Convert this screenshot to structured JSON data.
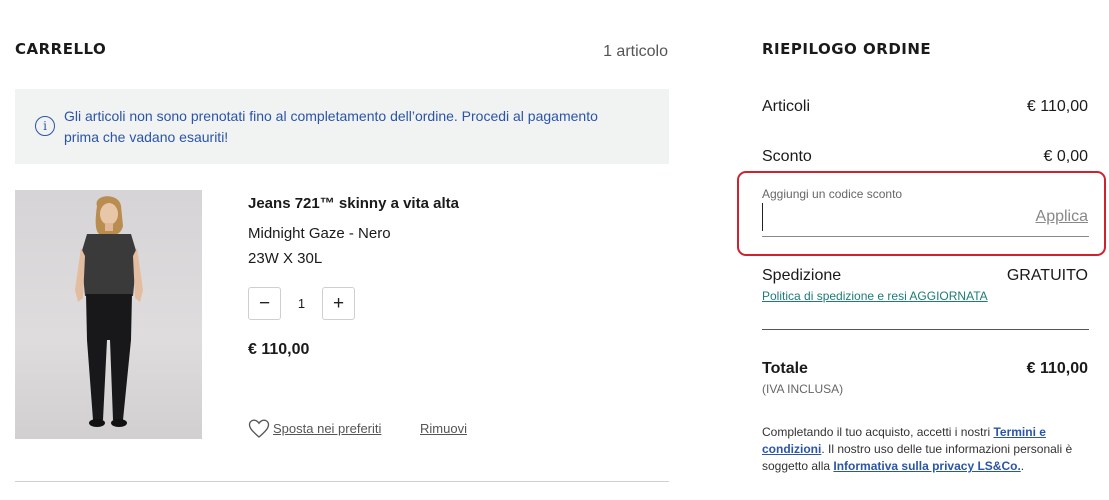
{
  "cart": {
    "title": "CARRELLO",
    "count": "1 articolo",
    "notice": "Gli articoli non sono prenotati fino al completamento dell’ordine. Procedi al pagamento prima che vadano esauriti!",
    "item": {
      "name": "Jeans 721™ skinny a vita alta",
      "color": "Midnight Gaze - Nero",
      "size": "23W X 30L",
      "quantity": "1",
      "minus": "−",
      "plus": "+",
      "price": "€ 110,00",
      "move_to_favorites": "Sposta nei preferiti",
      "remove": "Rimuovi"
    }
  },
  "summary": {
    "title": "RIEPILOGO ORDINE",
    "items_label": "Articoli",
    "items_value": "€ 110,00",
    "discount_label": "Sconto",
    "discount_value": "€ 0,00",
    "promo_label": "Aggiungi un codice sconto",
    "promo_value": "",
    "promo_apply": "Applica",
    "shipping_label": "Spedizione",
    "shipping_value": "GRATUITO",
    "shipping_link": "Politica di spedizione e resi AGGIORNATA",
    "total_label": "Totale",
    "total_value": "€ 110,00",
    "vat_note": "(IVA INCLUSA)",
    "legal_prefix": "Completando il tuo acquisto, accetti i nostri ",
    "terms_link": "Termini e condizioni",
    "legal_middle": ". Il nostro uso delle tue informazioni personali è soggetto alla ",
    "privacy_link": "Informativa sulla privacy LS&Co.",
    "legal_suffix": "."
  },
  "colors": {
    "info_blue": "#2a55a8",
    "highlight_red": "#d0222e",
    "link_teal": "#1d7c74"
  }
}
